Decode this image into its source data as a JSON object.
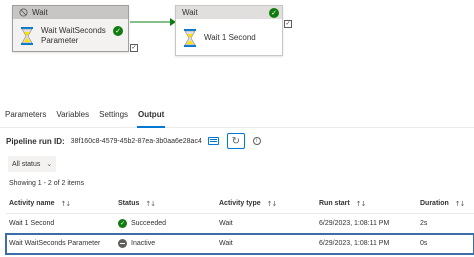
{
  "canvas": {
    "node1": {
      "header": "Wait",
      "name_line1": "Wait WaitSeconds",
      "name_line2": "Parameter",
      "icon": "hourglass-icon",
      "state": "inactive"
    },
    "node2": {
      "header": "Wait",
      "name": "Wait 1 Second",
      "icon": "hourglass-icon"
    },
    "colors": {
      "success": "#107c10",
      "connector": "#107c10",
      "accent": "#0078d4"
    }
  },
  "tabs": [
    {
      "label": "Parameters"
    },
    {
      "label": "Variables"
    },
    {
      "label": "Settings"
    },
    {
      "label": "Output",
      "active": true
    }
  ],
  "run": {
    "label": "Pipeline run ID:",
    "id": "38f160c8-4579-45b2-87ea-3b0aa6e28ac4"
  },
  "filter": {
    "label": "All status"
  },
  "showing": "Showing 1 - 2 of 2 items",
  "table": {
    "columns": [
      "Activity name",
      "Status",
      "Activity type",
      "Run start",
      "Duration"
    ],
    "rows": [
      {
        "name": "Wait 1 Second",
        "status": "Succeeded",
        "type": "Wait",
        "start": "6/29/2023, 1:08:11 PM",
        "duration": "2s"
      },
      {
        "name": "Wait WaitSeconds Parameter",
        "status": "Inactive",
        "type": "Wait",
        "start": "6/29/2023, 1:08:11 PM",
        "duration": "0s",
        "selected": true
      }
    ]
  }
}
